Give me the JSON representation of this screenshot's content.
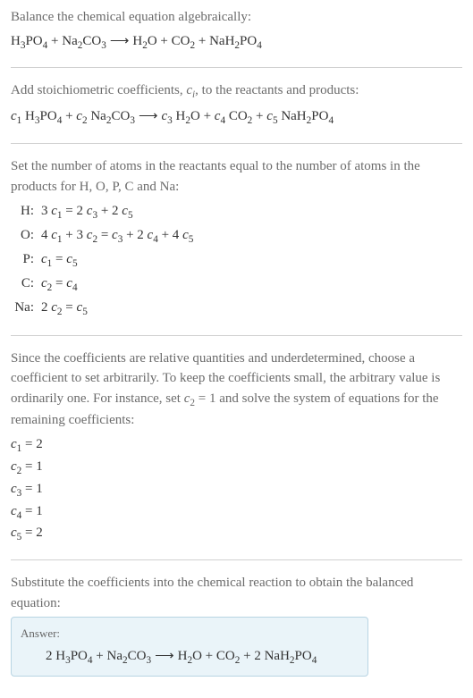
{
  "section1": {
    "text": "Balance the chemical equation algebraically:",
    "equation_parts": {
      "r1": "H",
      "r1s3": "3",
      "r1p": "PO",
      "r1s4": "4",
      "plus1": " + ",
      "r2": "Na",
      "r2s2": "2",
      "r2c": "CO",
      "r2s3": "3",
      "arrow": " ⟶ ",
      "p1": "H",
      "p1s2": "2",
      "p1o": "O",
      "plus2": " + ",
      "p2": "CO",
      "p2s2": "2",
      "plus3": " + ",
      "p3": "NaH",
      "p3s2": "2",
      "p3p": "PO",
      "p3s4": "4"
    }
  },
  "section2": {
    "text1": "Add stoichiometric coefficients, ",
    "text2": ", to the reactants and products:",
    "ci": "c",
    "ci_sub": "i",
    "coeff": {
      "c1": "c",
      "c1s": "1",
      "sp1": " ",
      "c2": "c",
      "c2s": "2",
      "sp2": " ",
      "c3": "c",
      "c3s": "3",
      "sp3": " ",
      "c4": "c",
      "c4s": "4",
      "sp4": " ",
      "c5": "c",
      "c5s": "5",
      "sp5": " "
    }
  },
  "section3": {
    "text": "Set the number of atoms in the reactants equal to the number of atoms in the products for H, O, P, C and Na:",
    "rows": [
      {
        "label": "H:",
        "lhs1": "3 ",
        "c1": "c",
        "c1s": "1",
        "eq": " = 2 ",
        "c3": "c",
        "c3s": "3",
        "plus": " + 2 ",
        "c5": "c",
        "c5s": "5"
      },
      {
        "label": "O:",
        "lhs1": "4 ",
        "c1": "c",
        "c1s": "1",
        "plus1": " + 3 ",
        "c2": "c",
        "c2s": "2",
        "eq": " = ",
        "c3": "c",
        "c3s": "3",
        "plus2": " + 2 ",
        "c4": "c",
        "c4s": "4",
        "plus3": " + 4 ",
        "c5": "c",
        "c5s": "5"
      },
      {
        "label": "P:",
        "c1": "c",
        "c1s": "1",
        "eq": " = ",
        "c5": "c",
        "c5s": "5"
      },
      {
        "label": "C:",
        "c2": "c",
        "c2s": "2",
        "eq": " = ",
        "c4": "c",
        "c4s": "4"
      },
      {
        "label": "Na:",
        "lhs1": "2 ",
        "c2": "c",
        "c2s": "2",
        "eq": " = ",
        "c5": "c",
        "c5s": "5"
      }
    ]
  },
  "section4": {
    "text1": "Since the coefficients are relative quantities and underdetermined, choose a coefficient to set arbitrarily. To keep the coefficients small, the arbitrary value is ordinarily one. For instance, set ",
    "c2": "c",
    "c2s": "2",
    "text2": " = 1 and solve the system of equations for the remaining coefficients:",
    "coeffs": [
      {
        "c": "c",
        "s": "1",
        "eq": " = 2"
      },
      {
        "c": "c",
        "s": "2",
        "eq": " = 1"
      },
      {
        "c": "c",
        "s": "3",
        "eq": " = 1"
      },
      {
        "c": "c",
        "s": "4",
        "eq": " = 1"
      },
      {
        "c": "c",
        "s": "5",
        "eq": " = 2"
      }
    ]
  },
  "section5": {
    "text": "Substitute the coefficients into the chemical reaction to obtain the balanced equation:",
    "answer_label": "Answer:",
    "balanced": {
      "n1": "2 ",
      "r1": "H",
      "r1s3": "3",
      "r1p": "PO",
      "r1s4": "4",
      "plus1": " + ",
      "r2": "Na",
      "r2s2": "2",
      "r2c": "CO",
      "r2s3": "3",
      "arrow": " ⟶ ",
      "p1": "H",
      "p1s2": "2",
      "p1o": "O",
      "plus2": " + ",
      "p2": "CO",
      "p2s2": "2",
      "plus3": " + ",
      "n2": "2 ",
      "p3": "NaH",
      "p3s2": "2",
      "p3p": "PO",
      "p3s4": "4"
    }
  }
}
